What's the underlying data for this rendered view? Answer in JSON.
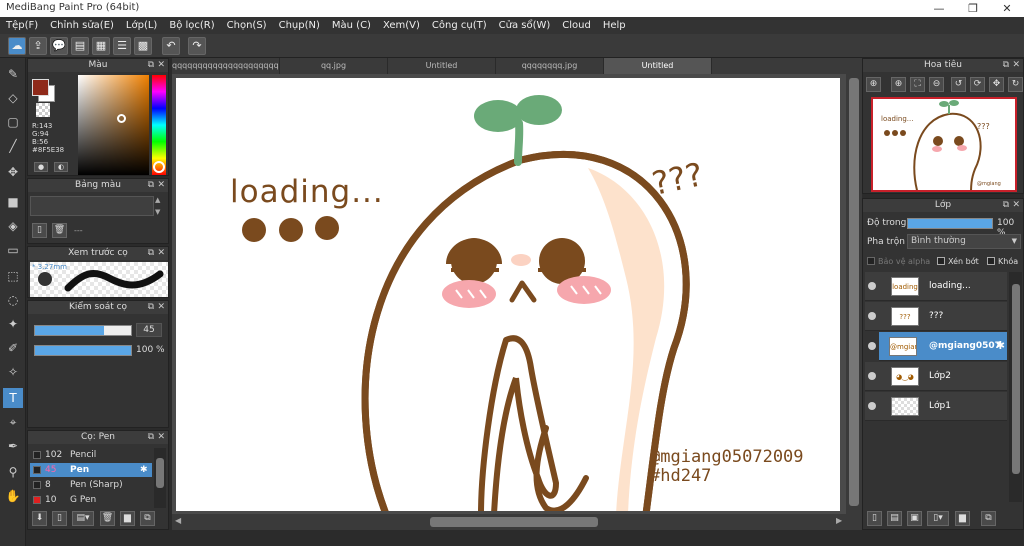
{
  "window": {
    "title": "MediBang Paint Pro (64bit)",
    "minimize": "—",
    "maximize": "❐",
    "close": "✕"
  },
  "menu": [
    "Tệp(F)",
    "Chỉnh sửa(E)",
    "Lớp(L)",
    "Bộ lọc(R)",
    "Chọn(S)",
    "Chụp(N)",
    "Màu (C)",
    "Xem(V)",
    "Công cụ(T)",
    "Cửa sổ(W)",
    "Cloud",
    "Help"
  ],
  "tabs": [
    "qqqqqqqqqqqqqqqqqqqqqqqqqq.jpg",
    "qq.jpg",
    "Untitled",
    "qqqqqqqq.jpg",
    "Untitled"
  ],
  "color_panel": {
    "title": "Màu",
    "r": "R:143",
    "g": "G:94",
    "b": "B:56",
    "hex": "#8F5E38",
    "fg_color": "#8f2a1a"
  },
  "palette_panel": {
    "title": "Bảng màu",
    "dash": "---"
  },
  "brush_preview": {
    "title": "Xem trước cọ",
    "size": "3.27mm"
  },
  "brush_control": {
    "title": "Kiểm soát cọ",
    "size_value": "45",
    "size_fraction": 0.72,
    "opacity_value": "100 %",
    "opacity_fraction": 1.0
  },
  "brush_list": {
    "title": "Cọ: Pen",
    "items": [
      {
        "size": "102",
        "name": "Pencil",
        "color": "#222222"
      },
      {
        "size": "45",
        "name": "Pen",
        "color": "#222222",
        "selected": true
      },
      {
        "size": "8",
        "name": "Pen (Sharp)",
        "color": "#222222"
      },
      {
        "size": "10",
        "name": "G Pen",
        "color": "#e02020"
      }
    ]
  },
  "navigator": {
    "title": "Hoa tiêu",
    "thumb_text": "loading..."
  },
  "layers_panel": {
    "title": "Lớp",
    "opacity_label": "Độ trong",
    "opacity_value": "100 %",
    "opacity_fraction": 1.0,
    "blend_label": "Pha trộn",
    "blend_value": "Bình thường",
    "protect_alpha": "Bảo vệ alpha",
    "clip": "Xén bớt",
    "lock": "Khóa",
    "layers": [
      {
        "name": "loading...",
        "thumb": "loading"
      },
      {
        "name": "???",
        "thumb": "???"
      },
      {
        "name": "@mgiang0507",
        "thumb": "@mgiang",
        "selected": true
      },
      {
        "name": "Lớp2",
        "thumb": "◕‿◕"
      },
      {
        "name": "Lớp1",
        "thumb": ""
      }
    ]
  },
  "artwork": {
    "loading": "loading...",
    "questions": "???",
    "handle": "@mgiang05072009",
    "tag": "#hd247"
  },
  "colors": {
    "accent": "#4a8cc9",
    "brown": "#7a4a1e",
    "sprout": "#6aaa78",
    "blush": "#f6a7ad",
    "skin": "#fde2cc"
  }
}
